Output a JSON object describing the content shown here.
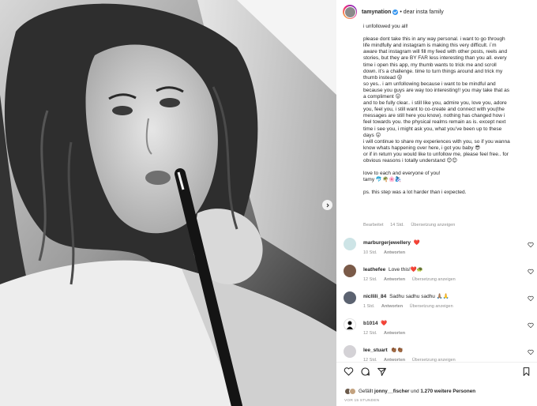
{
  "header": {
    "username": "tamynation",
    "separator": "•",
    "location": "dear insta family"
  },
  "caption": {
    "paragraphs": [
      "i unfollowed you all!",
      "",
      "please dont take this in any way personal. i want to go through\nlife mindfully and instagram is making this very difficult. i´m\naware that instagram will fill my feed with other posts, reels and\nstories, but they are BY FAR less interesting than you all. every\ntime i open this app, my thumb wants to trick me and scroll\ndown. it’s a challenge. time to turn things around and trick my\nthumb instead 😜\nso yes.. i am unfollowing because i want to be mindful and\nbecause you guys are way too interesting!! you may take that as\na compliment 😛\nand to be fully clear.. i still like you, admire you, love you, adore\nyou, feel you, i still want to co-create and connect with you(the\nmessages are still here you know). nothing has changed how i\nfeel towards you. the physical realms remain as is. except next\ntime i see you, i might ask you, what you’ve been up to these\ndays 😛\ni will continue to share my experiences with you, so if you wanna\nknow whats happening over here, i got you baby 😎\nor if in return you would like to unfollow me, please feel free.. for\nobvious reasons i totally understand 😊😊",
      "",
      "love to each and everyone of you!\ntamy 🐬🌴🌸🧞‍♀️",
      "",
      "ps. this step was a lot harder than i expected."
    ],
    "meta_edited": "Bearbeitet",
    "meta_time": "14 Std.",
    "meta_translate": "Übersetzung anzeigen"
  },
  "comments": [
    {
      "user": "marburgerjewellery",
      "text": "❤️",
      "time": "10 Std.",
      "reply": "Antworten",
      "translate": ""
    },
    {
      "user": "leathefee",
      "text": "Love this!❤️🐢",
      "time": "12 Std.",
      "reply": "Antworten",
      "translate": "Übersetzung anzeigen"
    },
    {
      "user": "nicllili_84",
      "text": "Sadhu sadhu sadhu 🙏🏽🙏",
      "time": "1 Std.",
      "reply": "Antworten",
      "translate": "Übersetzung anzeigen"
    },
    {
      "user": "b1014",
      "text": "❤️",
      "time": "12 Std.",
      "reply": "Antworten",
      "translate": ""
    },
    {
      "user": "lee_stuart",
      "text": "👏🏾👏🏾",
      "time": "12 Std.",
      "reply": "Antworten",
      "translate": "Übersetzung anzeigen"
    }
  ],
  "likes": {
    "prefix": "Gefällt",
    "user": "jonny__fischer",
    "middle": "und",
    "others": "1.270 weitere Personen"
  },
  "timestamp": "VOR 15 STUNDEN",
  "colors": {
    "text": "#262626",
    "muted": "#8e8e8e",
    "verified": "#3897f0",
    "heart_red": "#ed4956"
  },
  "icons": {
    "like": "heart-icon",
    "comment": "comment-icon",
    "share": "paper-plane-icon",
    "save": "bookmark-icon",
    "carousel_next": "chevron-right-icon"
  }
}
